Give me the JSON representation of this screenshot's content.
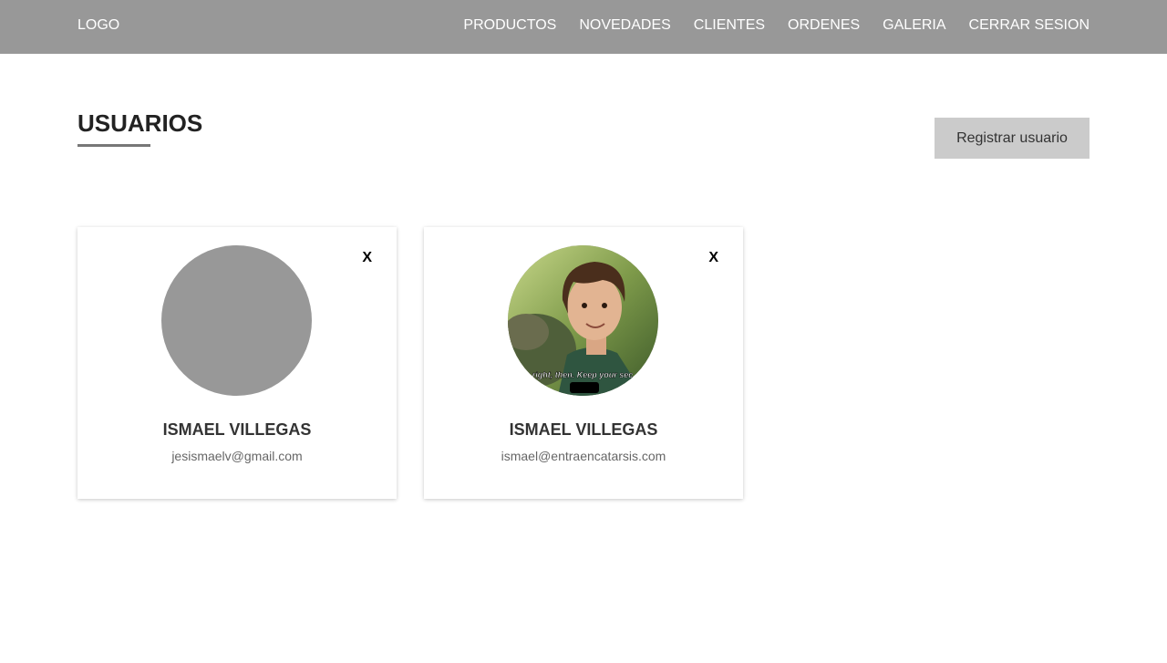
{
  "header": {
    "logo": "LOGO",
    "nav": [
      {
        "label": "PRODUCTOS"
      },
      {
        "label": "NOVEDADES"
      },
      {
        "label": "CLIENTES"
      },
      {
        "label": "ORDENES"
      },
      {
        "label": "GALERIA"
      },
      {
        "label": "CERRAR SESION"
      }
    ]
  },
  "main": {
    "title": "USUARIOS",
    "register_label": "Registrar usuario",
    "users": [
      {
        "name": "ISMAEL VILLEGAS",
        "email": "jesismaelv@gmail.com",
        "delete_label": "X",
        "avatar": "placeholder-avatar"
      },
      {
        "name": "ISMAEL VILLEGAS",
        "email": "ismael@entraencatarsis.com",
        "delete_label": "X",
        "avatar": "photo-avatar",
        "avatar_caption": "right, then. Keep your sec"
      }
    ]
  },
  "colors": {
    "navbar": "#989898",
    "button": "#cbcbcb",
    "avatar_placeholder": "#989898"
  }
}
